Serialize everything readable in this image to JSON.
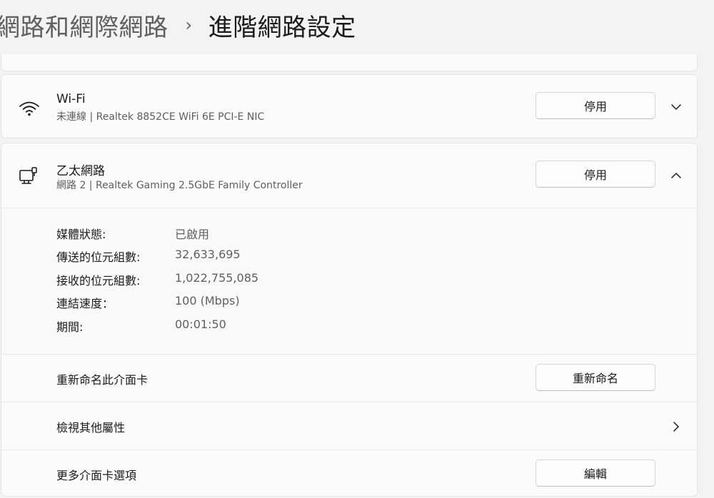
{
  "breadcrumb": {
    "parent": "網路和網際網路",
    "separator": "›",
    "current": "進階網路設定"
  },
  "adapters": {
    "wifi": {
      "icon": "wifi-icon",
      "name": "Wi-Fi",
      "description": "未連線 | Realtek 8852CE WiFi 6E PCI-E NIC",
      "button_label": "停用",
      "expanded": false
    },
    "ethernet": {
      "icon": "ethernet-icon",
      "name": "乙太網路",
      "description": "網路 2 | Realtek Gaming 2.5GbE Family Controller",
      "button_label": "停用",
      "expanded": true,
      "details": [
        {
          "label": "媒體狀態:",
          "value": "已啟用"
        },
        {
          "label": "傳送的位元組數:",
          "value": "32,633,695"
        },
        {
          "label": "接收的位元組數:",
          "value": "1,022,755,085"
        },
        {
          "label": "連結速度：",
          "value": "100 (Mbps)"
        },
        {
          "label": "期間:",
          "value": "00:01:50"
        }
      ],
      "actions": {
        "rename_label": "重新命名此介面卡",
        "rename_button": "重新命名",
        "properties_label": "檢視其他屬性",
        "more_label": "更多介面卡選項",
        "edit_button": "編輯"
      }
    }
  }
}
